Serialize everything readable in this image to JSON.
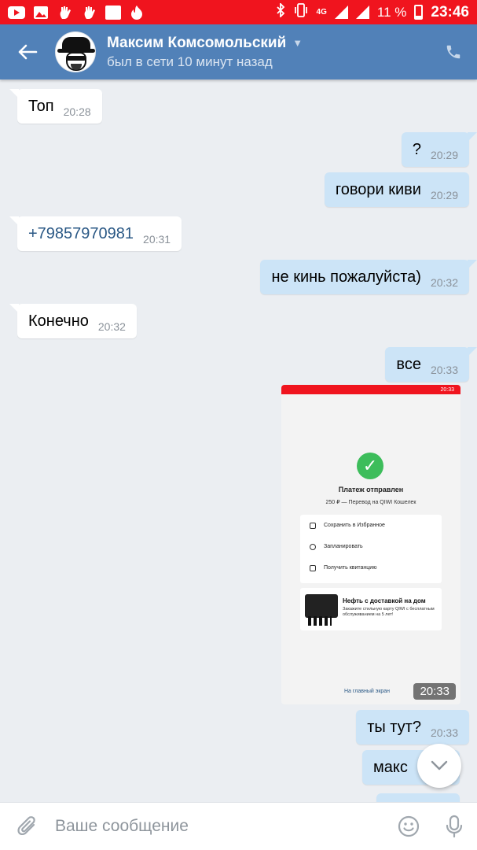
{
  "status_bar": {
    "battery": "11 %",
    "time": "23:46",
    "network": "4G",
    "icons": [
      "youtube-icon",
      "gallery-icon",
      "hand-icon",
      "hand-icon",
      "square-icon",
      "flame-icon",
      "bluetooth-icon",
      "vibrate-icon",
      "signal-icon",
      "signal-icon",
      "battery-icon"
    ]
  },
  "header": {
    "name": "Максим Комсомольский",
    "status": "был в сети 10 минут назад",
    "accent": "#5181b8"
  },
  "messages": [
    {
      "dir": "in",
      "text": "Топ",
      "time": "20:28"
    },
    {
      "dir": "out",
      "text": "?",
      "time": "20:29"
    },
    {
      "dir": "out",
      "text": "говори киви",
      "time": "20:29"
    },
    {
      "dir": "in",
      "text": "+79857970981",
      "time": "20:31"
    },
    {
      "dir": "out",
      "text": "не кинь пожалуйста)",
      "time": "20:32"
    },
    {
      "dir": "in",
      "text": "Конечно",
      "time": "20:32"
    },
    {
      "dir": "out",
      "text": "все",
      "time": "20:33"
    },
    {
      "dir": "out",
      "text": "ты тут?",
      "time": "20:33"
    },
    {
      "dir": "out",
      "text": "макс",
      "time": ""
    }
  ],
  "attachment": {
    "title": "Платеж отправлен",
    "subtitle": "250 ₽ — Перевод на QIWI Кошелек",
    "actions": [
      "Сохранить в Избранное",
      "Запланировать",
      "Получить квитанцию"
    ],
    "promo_title": "Нефть с доставкой на дом",
    "promo_text": "Закажите стильную карту QIWI с бесплатным обслуживанием на 5 лет!",
    "link": "На главный экран",
    "status_time": "20:33",
    "time": "20:33"
  },
  "composer": {
    "placeholder": "Ваше сообщение"
  }
}
